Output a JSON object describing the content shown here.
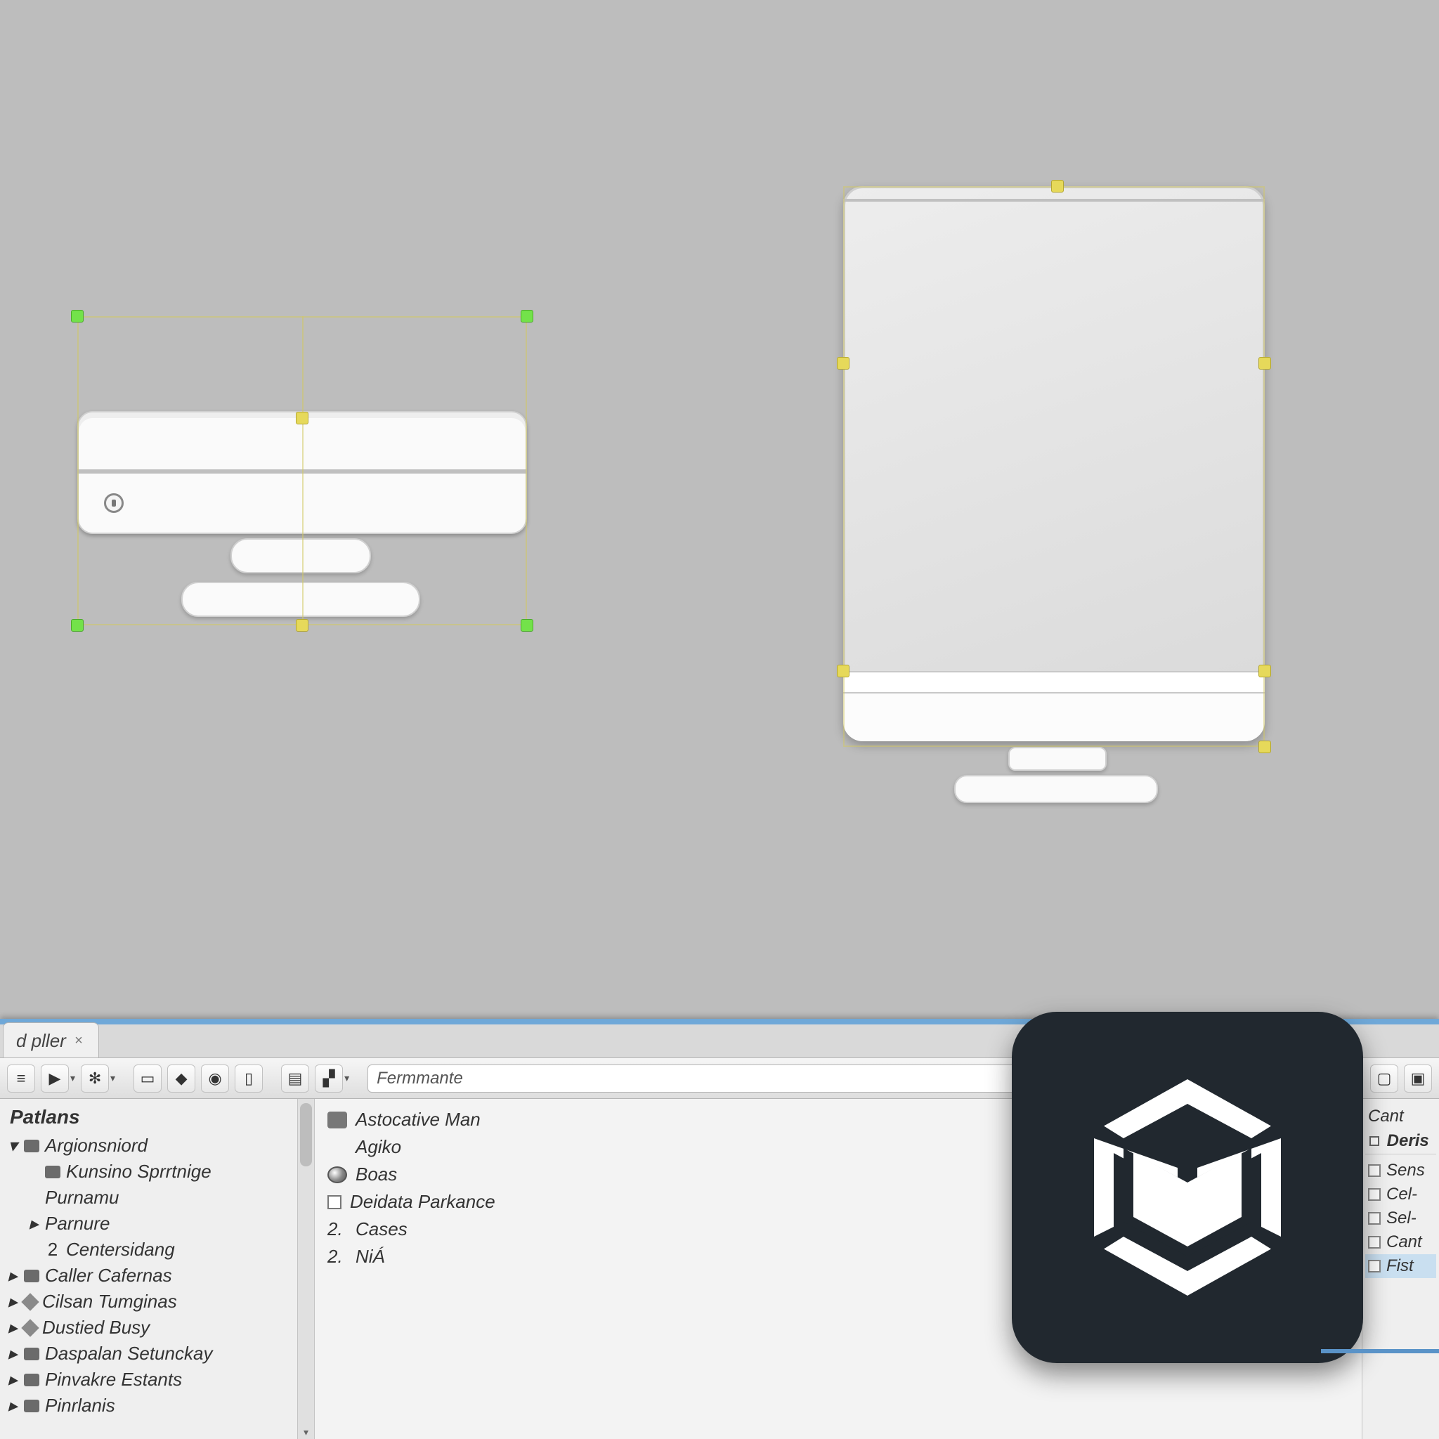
{
  "tab": {
    "label": "d pller"
  },
  "toolbar": {
    "search_placeholder": "Fermmante"
  },
  "left_panel": {
    "header": "Patlans",
    "items": [
      {
        "indent": 0,
        "icon": "folder",
        "arrow": "down",
        "label": "Argionsniord"
      },
      {
        "indent": 1,
        "icon": "folder",
        "arrow": "",
        "label": "Kunsino Sprrtnige"
      },
      {
        "indent": 1,
        "icon": "",
        "arrow": "",
        "label": "Purnamu"
      },
      {
        "indent": 1,
        "icon": "",
        "arrow": "right",
        "label": "Parnure"
      },
      {
        "indent": 1,
        "icon": "num",
        "num": "2",
        "label": "Centersidang"
      },
      {
        "indent": 0,
        "icon": "folder",
        "arrow": "right",
        "label": "Caller Cafernas"
      },
      {
        "indent": 0,
        "icon": "cube",
        "arrow": "right",
        "label": "Cilsan Tumginas"
      },
      {
        "indent": 0,
        "icon": "cube",
        "arrow": "right",
        "label": "Dustied Busy"
      },
      {
        "indent": 0,
        "icon": "folder",
        "arrow": "right",
        "label": "Daspalan Setunckay"
      },
      {
        "indent": 0,
        "icon": "folder",
        "arrow": "right",
        "label": "Pinvakre Estants"
      },
      {
        "indent": 0,
        "icon": "folder",
        "arrow": "right",
        "label": "Pinrlanis"
      }
    ]
  },
  "mid_panel": {
    "items": [
      {
        "icon": "folder",
        "label": "Astocative Man"
      },
      {
        "icon": "",
        "label": "Agiko"
      },
      {
        "icon": "globe",
        "label": "Boas"
      },
      {
        "icon": "cb",
        "label": "Deidata Parkance"
      },
      {
        "icon": "num",
        "num": "2.",
        "label": "Cases"
      },
      {
        "icon": "num",
        "num": "2.",
        "label": "NiÁ"
      }
    ]
  },
  "right_panel": {
    "tab": "Cant",
    "header": "Deris",
    "items": [
      {
        "label": "Sens"
      },
      {
        "label": "Cel-"
      },
      {
        "label": "Sel-"
      },
      {
        "label": "Cant"
      },
      {
        "label": "Fist",
        "selected": true
      }
    ]
  },
  "logo": {
    "name": "unity-logo"
  }
}
